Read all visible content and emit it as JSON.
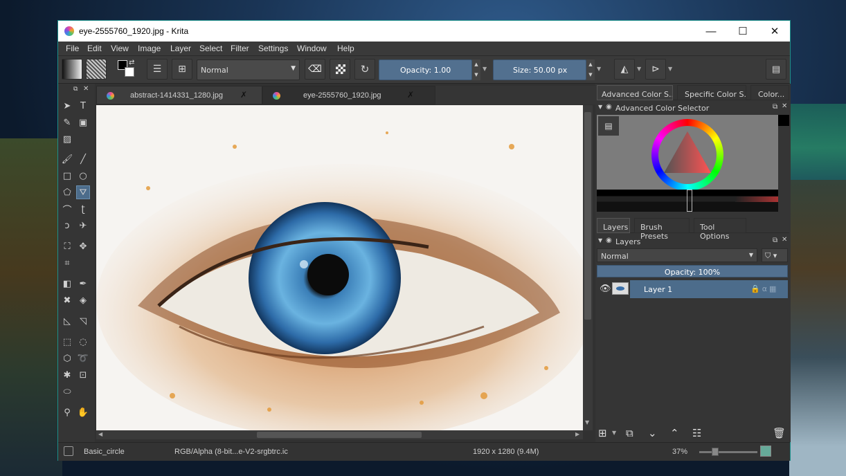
{
  "window": {
    "title": "eye-2555760_1920.jpg  - Krita",
    "controls": {
      "minimize": "—",
      "maximize": "☐",
      "close": "✕"
    }
  },
  "menu": [
    "File",
    "Edit",
    "View",
    "Image",
    "Layer",
    "Select",
    "Filter",
    "Settings",
    "Window",
    "Help"
  ],
  "toolbar": {
    "blend_mode": "Normal",
    "opacity_label": "Opacity:  1.00",
    "size_label": "Size:  50.00 px"
  },
  "tabs": [
    {
      "label": "abstract-1414331_1280.jpg",
      "active": false
    },
    {
      "label": "eye-2555760_1920.jpg",
      "active": true
    }
  ],
  "dock_tabs_top": [
    "Advanced Color S...",
    "Specific Color S...",
    "Color..."
  ],
  "color_selector": {
    "title": "Advanced Color Selector"
  },
  "dock_tabs_bottom": [
    "Layers",
    "Brush Presets",
    "Tool Options"
  ],
  "layers": {
    "title": "Layers",
    "blend_mode": "Normal",
    "opacity_label": "Opacity:  100%",
    "items": [
      {
        "name": "Layer 1",
        "visible": true,
        "selected": true
      }
    ]
  },
  "status": {
    "brush": "Basic_circle",
    "colorspace": "RGB/Alpha (8-bit...e-V2-srgbtrc.ic",
    "dimensions": "1920 x 1280 (9.4M)",
    "zoom": "37%"
  },
  "colors": {
    "accent": "#52708f",
    "selection": "#4c6c8b",
    "border": "#1c8f8a"
  }
}
